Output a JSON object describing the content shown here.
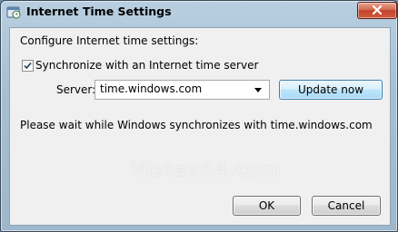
{
  "window": {
    "title": "Internet Time Settings",
    "icon": "time-settings-icon"
  },
  "dialog": {
    "heading": "Configure Internet time settings:",
    "sync_checkbox": {
      "label": "Synchronize with an Internet time server",
      "checked": true
    },
    "server": {
      "label": "Server:",
      "value": "time.windows.com"
    },
    "update_button": "Update now",
    "status": "Please wait while Windows synchronizes with time.windows.com",
    "ok_button": "OK",
    "cancel_button": "Cancel"
  },
  "watermark": "Vistax64.com",
  "colors": {
    "close_button": "#c0442b",
    "focus_border": "#3c7fb1"
  }
}
